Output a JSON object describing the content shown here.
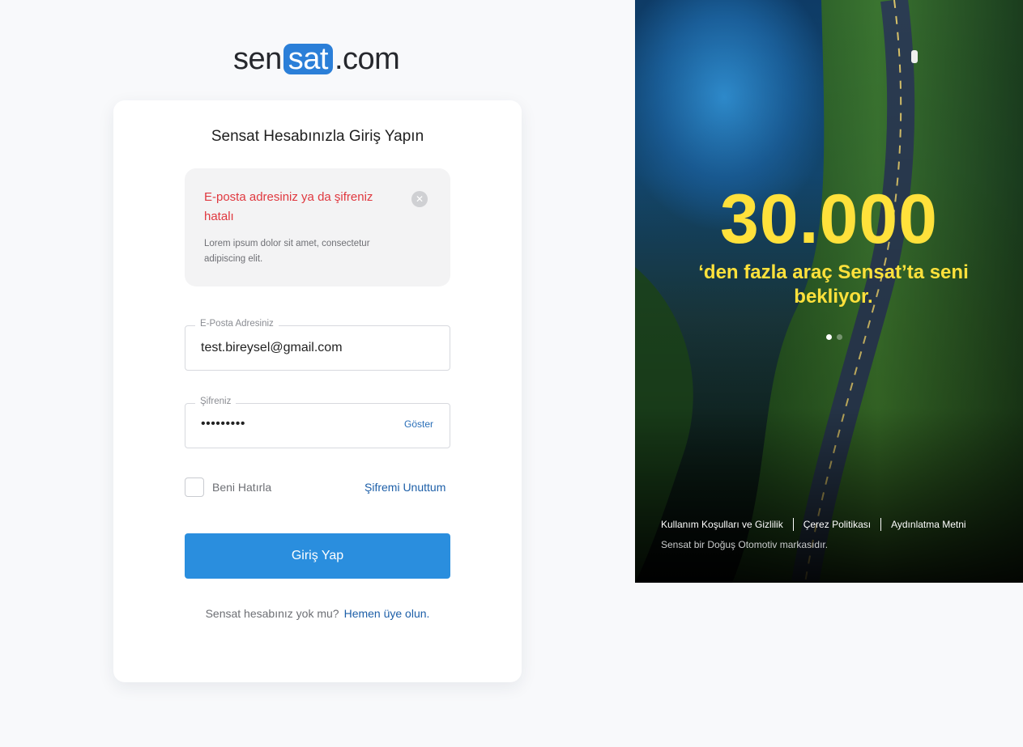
{
  "logo": {
    "prefix": "sen",
    "highlight": "sat",
    "suffix": ".com"
  },
  "card": {
    "title": "Sensat Hesabınızla Giriş Yapın",
    "alert": {
      "title": "E-posta adresiniz ya da şifreniz hatalı",
      "description": "Lorem ipsum dolor sit amet, consectetur adipiscing elit.",
      "close_icon": "✕"
    },
    "email": {
      "label": "E-Posta Adresiniz",
      "value": "test.bireysel@gmail.com"
    },
    "password": {
      "label": "Şifreniz",
      "masked_value": "•••••••••",
      "show_label": "Göster"
    },
    "remember_label": "Beni Hatırla",
    "forgot_label": "Şifremi Unuttum",
    "login_label": "Giriş Yap",
    "signup_text": "Sensat hesabınız yok mu?",
    "signup_link": "Hemen üye olun."
  },
  "hero": {
    "number": "30.000",
    "text": "‘den fazla araç Sensat’ta seni bekliyor.",
    "dots_total": 2,
    "dots_active": 1,
    "footer_links": [
      "Kullanım Koşulları ve Gizlilik",
      "Çerez Politikası",
      "Aydınlatma Metni"
    ],
    "footer_note": "Sensat bir Doğuş Otomotiv markasıdır.",
    "accent_color": "#ffe13b"
  },
  "colors": {
    "primary": "#2a8ede",
    "link": "#1d5fa8",
    "error": "#e0383f",
    "brand": "#2b7fd8"
  }
}
